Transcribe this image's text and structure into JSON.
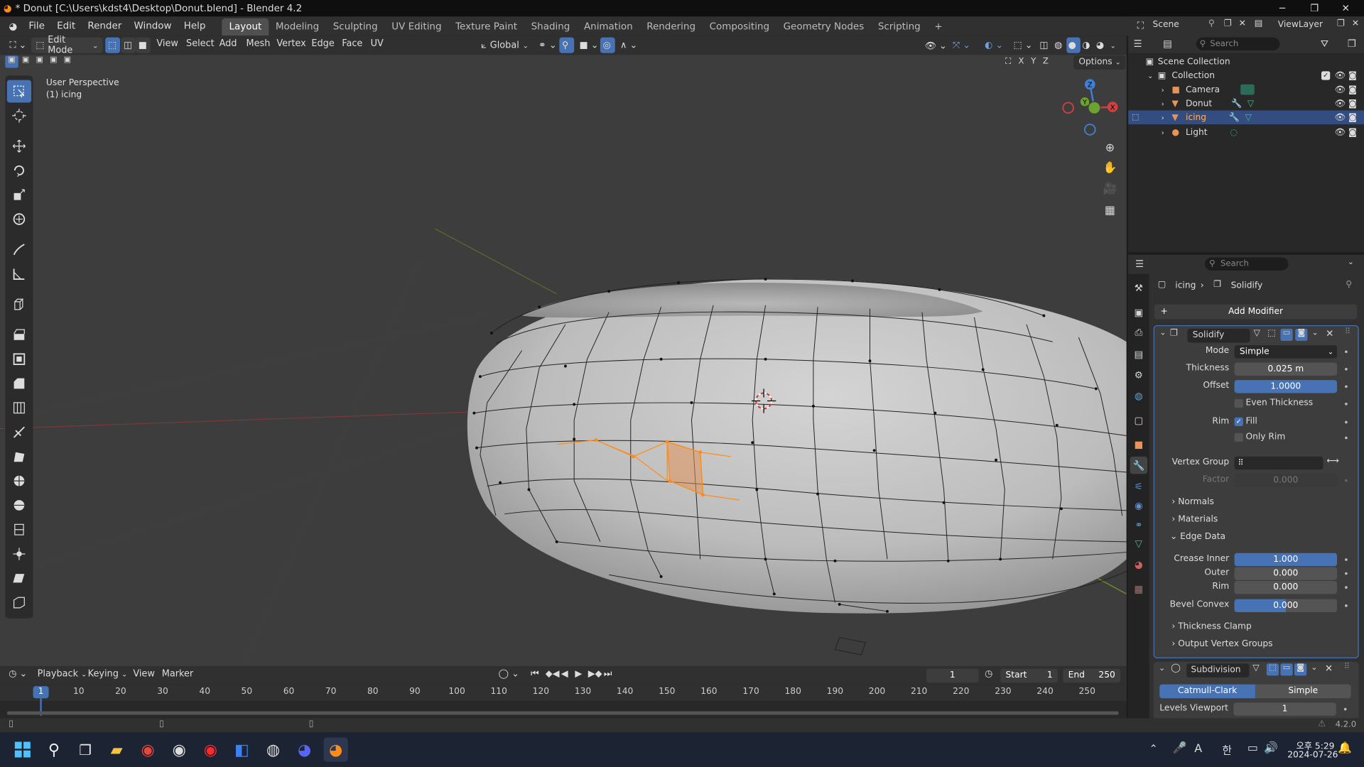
{
  "window": {
    "title": "* Donut [C:\\Users\\kdst4\\Desktop\\Donut.blend] - Blender 4.2"
  },
  "menu": [
    "File",
    "Edit",
    "Render",
    "Window",
    "Help"
  ],
  "workspaces": [
    "Layout",
    "Modeling",
    "Sculpting",
    "UV Editing",
    "Texture Paint",
    "Shading",
    "Animation",
    "Rendering",
    "Compositing",
    "Geometry Nodes",
    "Scripting"
  ],
  "active_workspace": "Layout",
  "scene_name": "Scene",
  "view_layer": "ViewLayer",
  "viewport": {
    "mode": "Edit Mode",
    "menus": [
      "View",
      "Select",
      "Add",
      "Mesh",
      "Vertex",
      "Edge",
      "Face",
      "UV"
    ],
    "orientation": "Global",
    "options_label": "Options",
    "overlay_line1": "User Perspective",
    "overlay_line2": "(1) icing",
    "axis_labels": [
      "X",
      "Y",
      "Z"
    ]
  },
  "outliner": {
    "search_placeholder": "Search",
    "root": "Scene Collection",
    "collection": "Collection",
    "items": [
      {
        "name": "Camera",
        "selected": false
      },
      {
        "name": "Donut",
        "selected": false
      },
      {
        "name": "icing",
        "selected": true
      },
      {
        "name": "Light",
        "selected": false
      }
    ]
  },
  "properties": {
    "search_placeholder": "Search",
    "breadcrumb_object": "icing",
    "breadcrumb_modifier": "Solidify",
    "add_modifier": "Add Modifier",
    "solidify": {
      "name": "Solidify",
      "mode_label": "Mode",
      "mode_value": "Simple",
      "thickness_label": "Thickness",
      "thickness_value": "0.025 m",
      "offset_label": "Offset",
      "offset_value": "1.0000",
      "even_thickness_label": "Even Thickness",
      "rim_label": "Rim",
      "fill_label": "Fill",
      "only_rim_label": "Only Rim",
      "vertex_group_label": "Vertex Group",
      "factor_label": "Factor",
      "factor_value": "0.000",
      "normals_label": "Normals",
      "materials_label": "Materials",
      "edge_data_label": "Edge Data",
      "crease_inner_label": "Crease Inner",
      "crease_inner_value": "1.000",
      "outer_label": "Outer",
      "outer_value": "0.000",
      "rim2_label": "Rim",
      "rim2_value": "0.000",
      "bevel_convex_label": "Bevel Convex",
      "bevel_convex_value": "0.000",
      "thickness_clamp_label": "Thickness Clamp",
      "output_vertex_groups_label": "Output Vertex Groups"
    },
    "subdivision": {
      "name": "Subdivision",
      "catmull_clark": "Catmull-Clark",
      "simple": "Simple",
      "levels_viewport_label": "Levels Viewport",
      "levels_viewport_value": "1"
    }
  },
  "timeline": {
    "menus": [
      "Playback",
      "Keying",
      "View",
      "Marker"
    ],
    "current_frame": "1",
    "start_label": "Start",
    "start_value": "1",
    "end_label": "End",
    "end_value": "250",
    "ticks": [
      "1",
      "10",
      "20",
      "30",
      "40",
      "50",
      "60",
      "70",
      "80",
      "90",
      "100",
      "110",
      "120",
      "130",
      "140",
      "150",
      "160",
      "170",
      "180",
      "190",
      "200",
      "210",
      "220",
      "230",
      "240",
      "250"
    ]
  },
  "status": {
    "version": "4.2.0"
  },
  "taskbar": {
    "time": "오후 5:29",
    "date": "2024-07-26",
    "lang": "A",
    "ime": "한"
  },
  "colors": {
    "accent": "#4772b3",
    "orange": "#ff8c1a",
    "bg": "#3d3d3d"
  }
}
